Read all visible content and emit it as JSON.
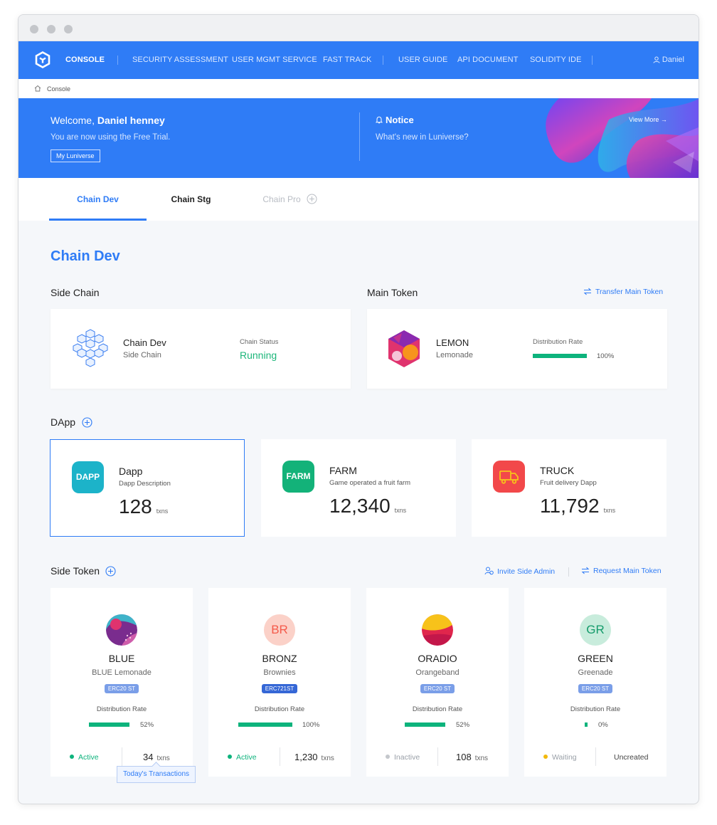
{
  "nav": {
    "items": [
      "CONSOLE",
      "SECURITY ASSESSMENT",
      "USER MGMT SERVICE",
      "FAST TRACK",
      "USER GUIDE",
      "API DOCUMENT",
      "SOLIDITY IDE"
    ],
    "user": "Daniel",
    "accent_color": "#2f7cf6"
  },
  "breadcrumb": {
    "label": "Console"
  },
  "banner": {
    "welcome_prefix": "Welcome, ",
    "welcome_name": "Daniel henney",
    "trial_text": "You are now using the Free Trial.",
    "my_button": "My Luniverse",
    "notice_title": "Notice",
    "notice_text": "What's new in Luniverse?",
    "view_more": "View More →"
  },
  "tabs": [
    {
      "label": "Chain Dev",
      "state": "active"
    },
    {
      "label": "Chain Stg",
      "state": "normal"
    },
    {
      "label": "Chain Pro",
      "state": "disabled"
    }
  ],
  "page_title": "Chain Dev",
  "side_chain": {
    "section_title": "Side Chain",
    "name": "Chain Dev",
    "sub": "Side Chain",
    "status_label": "Chain Status",
    "status_value": "Running"
  },
  "main_token": {
    "section_title": "Main Token",
    "transfer_link": "Transfer Main Token",
    "name": "LEMON",
    "sub": "Lemonade",
    "dr_label": "Distribution Rate",
    "dr_value": "100%",
    "dr_fraction": 1.0
  },
  "dapp": {
    "section_title": "DApp",
    "items": [
      {
        "icon_text": "DAPP",
        "color": "#1cb3c9",
        "name": "Dapp",
        "desc": "Dapp Description",
        "count": "128",
        "unit": "txns"
      },
      {
        "icon_text": "FARM",
        "color": "#13b279",
        "name": "FARM",
        "desc": "Game operated a fruit farm",
        "count": "12,340",
        "unit": "txns"
      },
      {
        "icon_text": "",
        "icon": "truck-icon",
        "color": "#f2484a",
        "name": "TRUCK",
        "desc": "Fruit delivery Dapp",
        "count": "11,792",
        "unit": "txns"
      }
    ]
  },
  "side_token": {
    "section_title": "Side Token",
    "invite_link": "Invite Side Admin",
    "request_link": "Request Main Token",
    "dr_label": "Distribution Rate",
    "tooltip": "Today's Transactions",
    "items": [
      {
        "avatar": "",
        "name": "BLUE",
        "sub": "BLUE Lemonade",
        "std": "ERC20 ST",
        "pct": "52%",
        "fraction": 0.52,
        "status": "Active",
        "status_color": "#0db37c",
        "count": "34",
        "unit": "txns"
      },
      {
        "avatar": "BR",
        "name": "BRONZ",
        "sub": "Brownies",
        "std": "ERC721ST",
        "pct": "100%",
        "fraction": 1.0,
        "status": "Active",
        "status_color": "#0db37c",
        "count": "1,230",
        "unit": "txns"
      },
      {
        "avatar": "",
        "name": "ORADIO",
        "sub": "Orangeband",
        "std": "ERC20 ST",
        "pct": "52%",
        "fraction": 0.52,
        "status": "Inactive",
        "status_color": "#c4c7cc",
        "count": "108",
        "unit": "txns"
      },
      {
        "avatar": "GR",
        "name": "GREEN",
        "sub": "Greenade",
        "std": "ERC20 ST",
        "pct": "0%",
        "fraction": 0.0,
        "status": "Waiting",
        "status_color": "#f2b90c",
        "count": "",
        "unit": "",
        "uncreated": "Uncreated"
      }
    ]
  }
}
